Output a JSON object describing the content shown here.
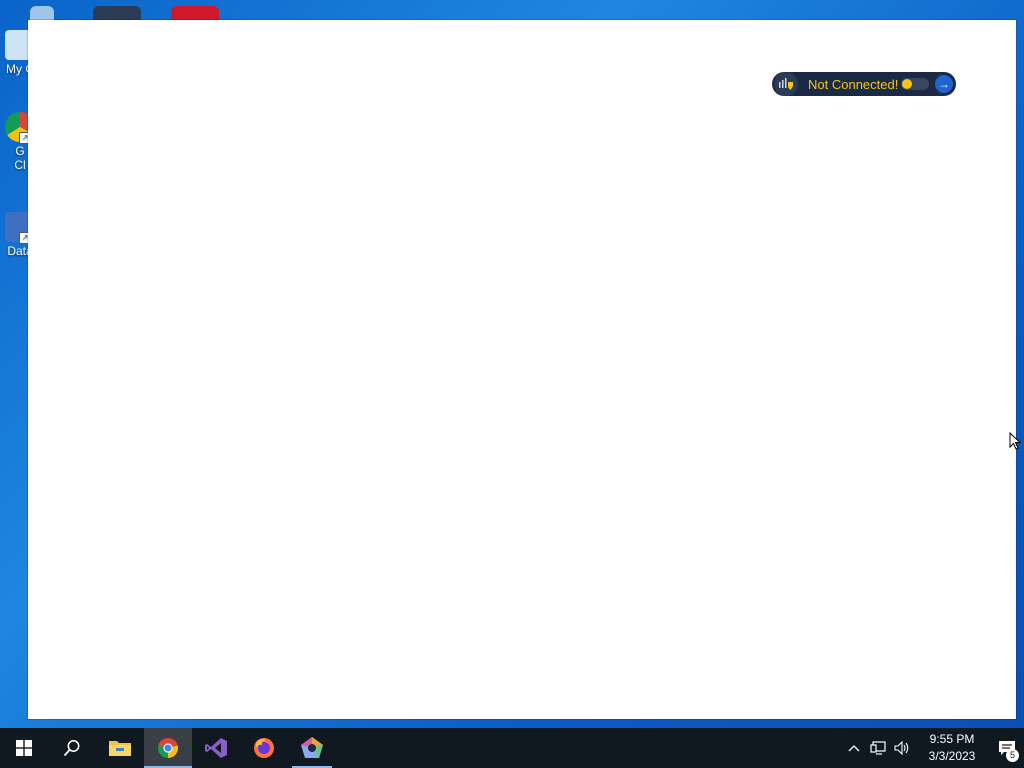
{
  "desktop": {
    "icons": [
      {
        "label": "My C",
        "icon": "computer-icon"
      },
      {
        "label": "G",
        "label2": "Cl",
        "icon": "chrome-shortcut-icon"
      },
      {
        "label": "Data",
        "icon": "data-shortcut-icon"
      }
    ]
  },
  "vpn_widget": {
    "status": "Not Connected!",
    "status_color": "#f5c518",
    "toggle_on": false,
    "icons": [
      "signal-shield-icon",
      "arrow-right-icon"
    ]
  },
  "taskbar": {
    "apps": [
      {
        "name": "start",
        "icon": "windows-start-icon"
      },
      {
        "name": "search",
        "icon": "search-icon"
      },
      {
        "name": "file-explorer",
        "icon": "folder-icon"
      },
      {
        "name": "chrome",
        "icon": "chrome-icon",
        "active": true
      },
      {
        "name": "visual-studio",
        "icon": "visual-studio-icon"
      },
      {
        "name": "firefox",
        "icon": "firefox-icon"
      },
      {
        "name": "app-pentagon",
        "icon": "pentagon-app-icon",
        "running": true
      }
    ],
    "tray": {
      "time": "9:55 PM",
      "date": "3/3/2023",
      "notification_count": "5"
    }
  },
  "colors": {
    "taskbar_bg": "#101820",
    "desktop_accent": "#1e86e0",
    "window_bg": "#ffffff"
  }
}
